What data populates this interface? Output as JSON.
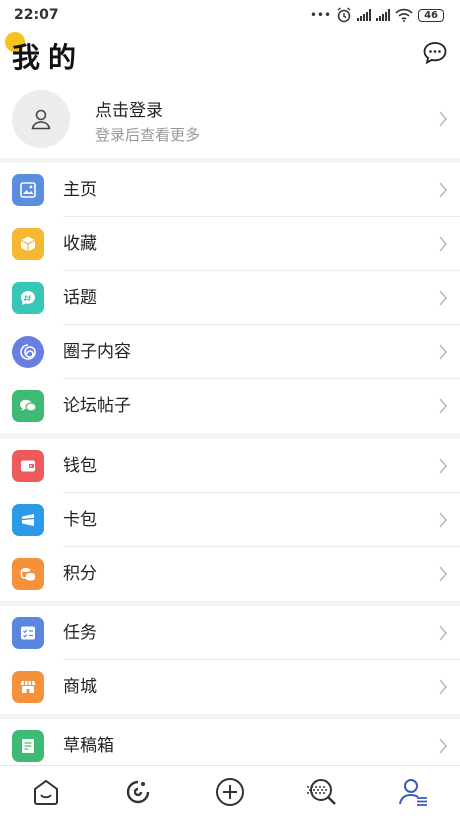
{
  "status": {
    "time": "22:07",
    "battery": "46"
  },
  "header": {
    "title": "我的"
  },
  "profile": {
    "title": "点击登录",
    "subtitle": "登录后查看更多"
  },
  "groups": [
    {
      "items": [
        {
          "label": "主页",
          "icon": "image-icon",
          "color": "#5b8de0"
        },
        {
          "label": "收藏",
          "icon": "box-icon",
          "color": "#f6b732"
        },
        {
          "label": "话题",
          "icon": "hashtag-icon",
          "color": "#36c7b6"
        },
        {
          "label": "圈子内容",
          "icon": "swirl-icon",
          "color": "#6a7de0"
        },
        {
          "label": "论坛帖子",
          "icon": "chat-icon",
          "color": "#3fba74"
        }
      ]
    },
    {
      "items": [
        {
          "label": "钱包",
          "icon": "wallet-icon",
          "color": "#f05a5a"
        },
        {
          "label": "卡包",
          "icon": "card-icon",
          "color": "#2b9ae8"
        },
        {
          "label": "积分",
          "icon": "coins-icon",
          "color": "#f5913a"
        }
      ]
    },
    {
      "items": [
        {
          "label": "任务",
          "icon": "checklist-icon",
          "color": "#5a86de"
        },
        {
          "label": "商城",
          "icon": "store-icon",
          "color": "#f5913a"
        }
      ]
    },
    {
      "items": [
        {
          "label": "草稿箱",
          "icon": "draft-icon",
          "color": "#3fba74"
        }
      ]
    }
  ],
  "tabbar": {
    "active_color": "#3a5bbf",
    "inactive_color": "#333333"
  }
}
